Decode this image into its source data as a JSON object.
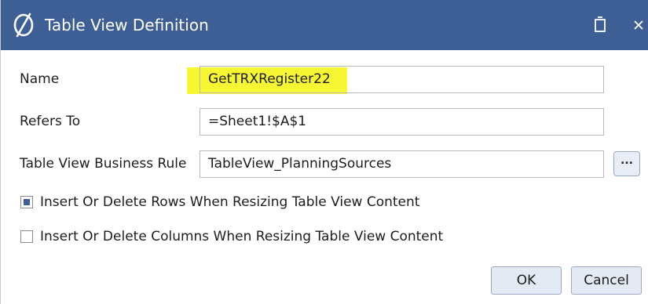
{
  "window": {
    "title": "Table View Definition",
    "logo_icon": "onestream-logo-icon",
    "restore_icon": "restore-icon",
    "close_icon": "close-icon",
    "titlebar_color": "#3e5f96",
    "close_glyph": "×"
  },
  "form": {
    "name_label": "Name",
    "name_value": "GetTRXRegister22",
    "name_highlight_color": "#f6f632",
    "refers_to_label": "Refers To",
    "refers_to_value": "=Sheet1!$A$1",
    "business_rule_label": "Table View Business Rule",
    "business_rule_value": "TableView_PlanningSources",
    "browse_label": "..."
  },
  "options": [
    {
      "label": "Insert Or Delete Rows When Resizing Table View Content",
      "checked": true
    },
    {
      "label": "Insert Or Delete Columns When Resizing Table View Content",
      "checked": false
    }
  ],
  "buttons": {
    "ok_label": "OK",
    "cancel_label": "Cancel"
  }
}
